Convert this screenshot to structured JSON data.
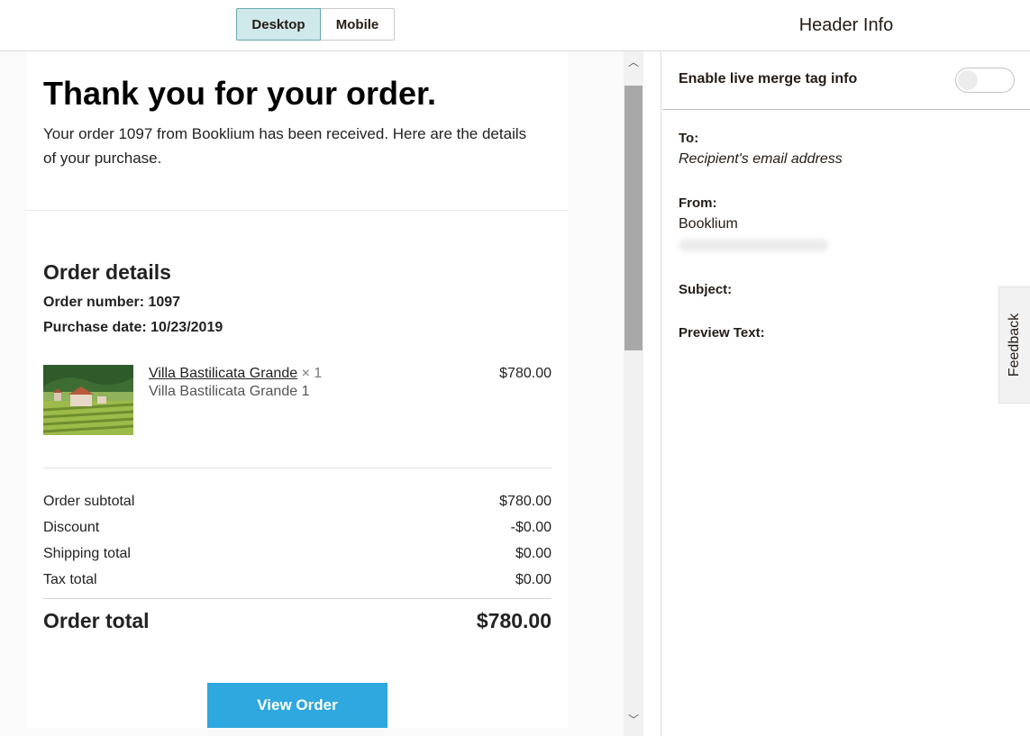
{
  "toolbar": {
    "desktop_label": "Desktop",
    "mobile_label": "Mobile",
    "active": "Desktop"
  },
  "email": {
    "title": "Thank you for your order.",
    "intro": "Your order 1097 from Booklium has been received. Here are the details of your purchase.",
    "details_heading": "Order details",
    "order_number": "Order number: 1097",
    "purchase_date": "Purchase date: 10/23/2019",
    "item": {
      "name": "Villa Bastilicata Grande",
      "qty": " × 1",
      "variant": "Villa Bastilicata Grande 1",
      "price": "$780.00"
    },
    "totals": [
      {
        "label": "Order subtotal",
        "value": "$780.00"
      },
      {
        "label": "Discount",
        "value": "-$0.00"
      },
      {
        "label": "Shipping total",
        "value": "$0.00"
      },
      {
        "label": "Tax total",
        "value": "$0.00"
      }
    ],
    "grand_total_label": "Order total",
    "grand_total_value": "$780.00",
    "button_label": "View Order"
  },
  "scrollbar": {
    "up_glyph": "︿",
    "down_glyph": "﹀"
  },
  "header_info": {
    "title": "Header Info",
    "toggle_label": "Enable live merge tag info",
    "toggle_on": false,
    "to_label": "To:",
    "to_value": "Recipient's email address",
    "from_label": "From:",
    "from_value": "Booklium",
    "subject_label": "Subject:",
    "preview_label": "Preview Text:",
    "feedback_label": "Feedback"
  },
  "colors": {
    "active_segment": "#cfe8ea",
    "button": "#2ea8de"
  }
}
